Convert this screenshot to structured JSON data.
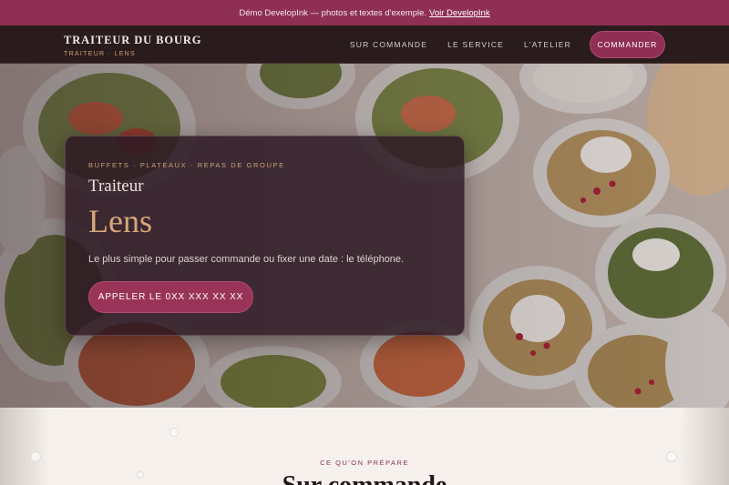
{
  "demo_bar": {
    "text": "Démo DevelopInk — photos et textes d'exemple.",
    "link": "Voir DevelopInk"
  },
  "header": {
    "brand_name": "TRAITEUR DU BOURG",
    "brand_sub": "TRAITEUR · LENS",
    "nav": [
      "SUR COMMANDE",
      "LE SERVICE",
      "L'ATELIER"
    ],
    "cta": "COMMANDER"
  },
  "hero": {
    "eyebrow": "BUFFETS · PLATEAUX · REPAS DE GROUPE",
    "title": "Traiteur",
    "city": "Lens",
    "text": "Le plus simple pour passer commande ou fixer une date : le téléphone.",
    "button": "APPELER LE 0XX XXX XX XX"
  },
  "section": {
    "eyebrow": "CE QU'ON PRÉPARE",
    "title": "Sur commande"
  },
  "colors": {
    "brand": "#8e2f53",
    "nav_bg": "#2a1b1d",
    "accent_gold": "#c9a27a",
    "cream": "#f6f1ec"
  },
  "icons": [
    "dish-photo"
  ]
}
